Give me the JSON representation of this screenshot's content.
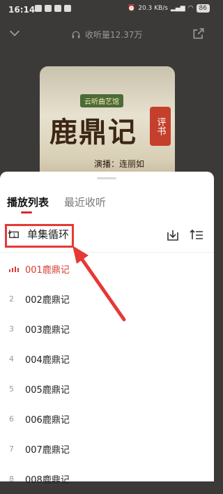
{
  "status": {
    "time": "16:14",
    "net_speed": "20.3 KB/s",
    "battery": "86"
  },
  "header": {
    "listen_count": "收听量12.37万"
  },
  "cover": {
    "badge": "云听曲艺馆",
    "title": "鹿鼎记",
    "seal": "评书",
    "narrator": "演播：连丽如"
  },
  "tabs": [
    {
      "label": "播放列表",
      "active": true
    },
    {
      "label": "最近收听",
      "active": false
    }
  ],
  "mode": {
    "label": "单集循环"
  },
  "episodes": [
    {
      "num": "",
      "name": "001鹿鼎记",
      "active": true
    },
    {
      "num": "2",
      "name": "002鹿鼎记"
    },
    {
      "num": "3",
      "name": "003鹿鼎记"
    },
    {
      "num": "4",
      "name": "004鹿鼎记"
    },
    {
      "num": "5",
      "name": "005鹿鼎记"
    },
    {
      "num": "6",
      "name": "006鹿鼎记"
    },
    {
      "num": "7",
      "name": "007鹿鼎记"
    },
    {
      "num": "8",
      "name": "008鹿鼎记"
    }
  ],
  "colors": {
    "accent": "#e3262f",
    "annotation": "#e53935"
  }
}
